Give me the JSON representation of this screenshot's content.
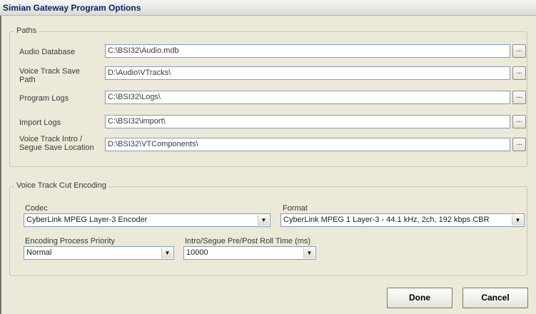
{
  "window": {
    "title": "Simian Gateway Program Options"
  },
  "paths": {
    "legend": "Paths",
    "rows": [
      {
        "label": "Audio Database",
        "value": "C:\\BSI32\\Audio.mdb"
      },
      {
        "label": "Voice Track Save Path",
        "value": "D:\\Audio\\VTracks\\"
      },
      {
        "label": "Program Logs",
        "value": "C:\\BSI32\\Logs\\"
      },
      {
        "label": "Import Logs",
        "value": "C:\\BSI32\\import\\"
      },
      {
        "label": "Voice Track Intro / Segue Save Location",
        "value": "D:\\BSI32\\VTComponents\\"
      }
    ],
    "browse_label": "..."
  },
  "encoding": {
    "legend": "Voice Track Cut Encoding",
    "codec": {
      "label": "Codec",
      "value": "CyberLink MPEG Layer-3 Encoder"
    },
    "format": {
      "label": "Format",
      "value": "CyberLink MPEG 1 Layer-3 - 44.1 kHz, 2ch,  192 kbps CBR"
    },
    "priority": {
      "label": "Encoding Process Priority",
      "value": "Normal"
    },
    "roll_time": {
      "label": "Intro/Segue Pre/Post Roll Time (ms)",
      "value": "10000"
    },
    "dropdown_arrow": "▼"
  },
  "buttons": {
    "done": "Done",
    "cancel": "Cancel"
  }
}
